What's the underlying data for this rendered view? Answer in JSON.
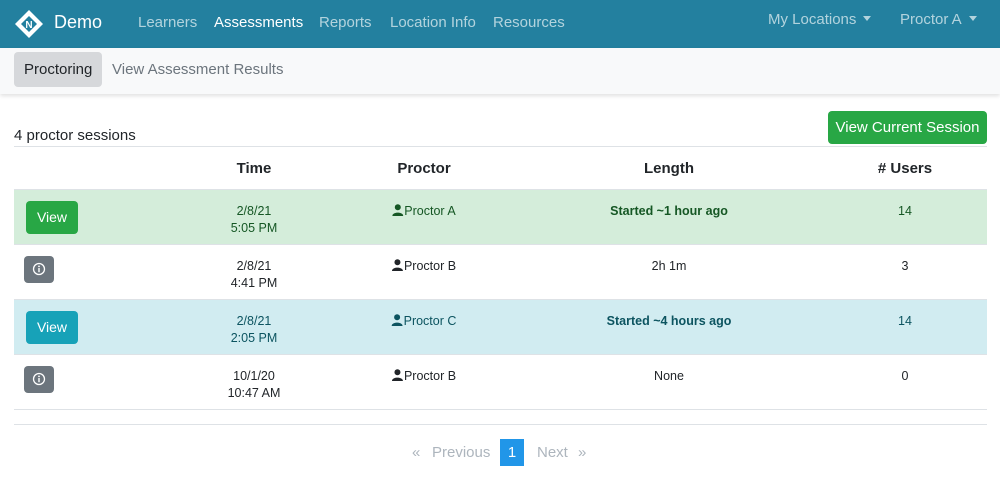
{
  "colors": {
    "navbar": "#23809f",
    "green": "#28a745",
    "teal": "#17a2b8",
    "pagination_active": "#2196e8"
  },
  "navbar": {
    "brand": "Demo",
    "logo_letter": "N",
    "links": [
      "Learners",
      "Assessments",
      "Reports",
      "Location Info",
      "Resources"
    ],
    "active_link": "Assessments",
    "locations_menu": "My Locations",
    "user_menu": "Proctor A"
  },
  "subnav": {
    "tabs": [
      "Proctoring",
      "View Assessment Results"
    ],
    "active_tab": "Proctoring"
  },
  "content": {
    "count_text": "4 proctor sessions",
    "view_current_button": "View Current Session",
    "columns": [
      "Time",
      "Proctor",
      "Length",
      "# Users"
    ],
    "rows": [
      {
        "date": "2/8/21",
        "time": "5:05 PM",
        "proctor": "Proctor A",
        "length": "Started ~1 hour ago",
        "users": "14",
        "action": "View",
        "style": "green"
      },
      {
        "date": "2/8/21",
        "time": "4:41 PM",
        "proctor": "Proctor B",
        "length": "2h 1m",
        "users": "3",
        "action": "info-icon",
        "style": "plain"
      },
      {
        "date": "2/8/21",
        "time": "2:05 PM",
        "proctor": "Proctor C",
        "length": "Started ~4 hours ago",
        "users": "14",
        "action": "View",
        "style": "teal"
      },
      {
        "date": "10/1/20",
        "time": "10:47 AM",
        "proctor": "Proctor B",
        "length": "None",
        "users": "0",
        "action": "info-icon",
        "style": "plain"
      }
    ]
  },
  "pagination": {
    "first": "«",
    "previous": "Previous",
    "current": "1",
    "next": "Next",
    "last": "»"
  }
}
